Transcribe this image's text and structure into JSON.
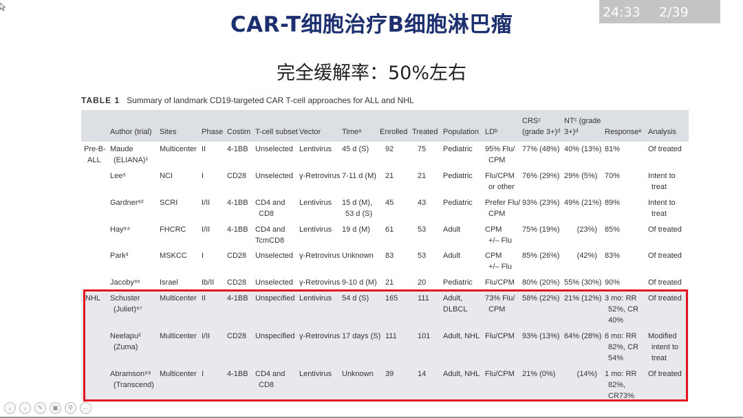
{
  "slide": {
    "title": "CAR-T细胞治疗B细胞淋巴瘤",
    "subtitle": "完全缓解率：50%左右",
    "timer": {
      "elapsed": "24:33",
      "page": "2/39"
    }
  },
  "table": {
    "caption_label": "TABLE 1",
    "caption_text": "Summary of landmark CD19-targeted CAR T-cell approaches for ALL and NHL",
    "headers": [
      "Author (trial)",
      "Sites",
      "Phase",
      "Costim",
      "T-cell subset",
      "Vector",
      "Timeᵃ",
      "Enrolled",
      "Treated",
      "Population",
      "LDᵇ",
      "CRSᶜ (grade 3+)ᵈ",
      "NTᶜ (grade 3+)ᵈ",
      "Responseᵉ",
      "Analysis"
    ],
    "groups": {
      "preb_line1": "Pre-B-",
      "preb_line2": "ALL",
      "nhl": "NHL"
    },
    "rows": [
      {
        "author": [
          "Maude",
          "(ELIANA)¹"
        ],
        "sites": "Multicenter",
        "phase": "II",
        "costim": "4-1BB",
        "tcell": [
          "Unselected"
        ],
        "vector": "Lentivirus",
        "time": [
          "45 d (S)"
        ],
        "enrolled": "92",
        "treated": "75",
        "population": [
          "Pediatric"
        ],
        "ld": [
          "95% Flu/",
          "CPM"
        ],
        "crs": "77% (48%)",
        "nt": "40% (13%)",
        "response": [
          "81%"
        ],
        "analysis": [
          "Of treated"
        ]
      },
      {
        "author": [
          "Lee⁵"
        ],
        "sites": "NCI",
        "phase": "I",
        "costim": "CD28",
        "tcell": [
          "Unselected"
        ],
        "vector": "γ-Retrovirus",
        "time": [
          "7-11 d (M)"
        ],
        "enrolled": "21",
        "treated": "21",
        "population": [
          "Pediatric"
        ],
        "ld": [
          "Flu/CPM",
          "or other"
        ],
        "crs": "76% (29%)",
        "nt": "29% (5%)",
        "response": [
          "70%"
        ],
        "analysis": [
          "Intent to",
          "treat"
        ]
      },
      {
        "author": [
          "Gardner⁸²"
        ],
        "sites": "SCRI",
        "phase": "I/II",
        "costim": "4-1BB",
        "tcell": [
          "CD4 and",
          "CD8"
        ],
        "vector": "Lentivirus",
        "time": [
          "15 d (M),",
          "53 d (S)"
        ],
        "enrolled": "45",
        "treated": "43",
        "population": [
          "Pediatric"
        ],
        "ld": [
          "Prefer Flu/",
          "CPM"
        ],
        "crs": "93% (23%)",
        "nt": "49% (21%)",
        "response": [
          "89%"
        ],
        "analysis": [
          "Intent to",
          "treat"
        ]
      },
      {
        "author": [
          "Hay⁸⁴"
        ],
        "sites": "FHCRC",
        "phase": "I/II",
        "costim": "4-1BB",
        "tcell": [
          "CD4 and",
          "TcmCD8"
        ],
        "vector": "Lentivirus",
        "time": [
          "19 d (M)"
        ],
        "enrolled": "61",
        "treated": "53",
        "population": [
          "Adult"
        ],
        "ld": [
          "CPM",
          "+/– Flu"
        ],
        "crs": "75% (19%)",
        "nt": "(23%)",
        "response": [
          "85%"
        ],
        "analysis": [
          "Of treated"
        ]
      },
      {
        "author": [
          "Park³"
        ],
        "sites": "MSKCC",
        "phase": "I",
        "costim": "CD28",
        "tcell": [
          "Unselected"
        ],
        "vector": "γ-Retrovirus",
        "time": [
          "Unknown"
        ],
        "enrolled": "83",
        "treated": "53",
        "population": [
          "Adult"
        ],
        "ld": [
          "CPM",
          "+/– Flu"
        ],
        "crs": "85% (26%)",
        "nt": "(42%)",
        "response": [
          "83%"
        ],
        "analysis": [
          "Of treated"
        ]
      },
      {
        "author": [
          "Jacoby⁸⁶"
        ],
        "sites": "Israel",
        "phase": "Ib/II",
        "costim": "CD28",
        "tcell": [
          "Unselected"
        ],
        "vector": "γ-Retrovirus",
        "time": [
          "9-10 d (M)"
        ],
        "enrolled": "21",
        "treated": "20",
        "population": [
          "Pediatric"
        ],
        "ld": [
          "Flu/CPM"
        ],
        "crs": "80% (20%)",
        "nt": "55% (30%)",
        "response": [
          "90%"
        ],
        "analysis": [
          "Of treated"
        ]
      },
      {
        "author": [
          "Schuster",
          "(Juliet)⁹⁷"
        ],
        "sites": "Multicenter",
        "phase": "II",
        "costim": "4-1BB",
        "tcell": [
          "Unspecified"
        ],
        "vector": "Lentivirus",
        "time": [
          "54 d (S)"
        ],
        "enrolled": "165",
        "treated": "111",
        "population": [
          "Adult,",
          "DLBCL"
        ],
        "ld": [
          "73% Flu/",
          "CPM"
        ],
        "crs": "58% (22%)",
        "nt": "21% (12%)",
        "response": [
          "3 mo: RR",
          "52%, CR",
          "40%"
        ],
        "analysis": [
          "Of treated"
        ]
      },
      {
        "author": [
          "Neelapu²",
          "(Zuma)"
        ],
        "sites": "Multicenter",
        "phase": "I/II",
        "costim": "CD28",
        "tcell": [
          "Unspecified"
        ],
        "vector": "γ-Retrovirus",
        "time": [
          "17 days (S)"
        ],
        "enrolled": "111",
        "treated": "101",
        "population": [
          "Adult, NHL"
        ],
        "ld": [
          "Flu/CPM"
        ],
        "crs": "93% (13%)",
        "nt": "64% (28%)",
        "response": [
          "6 mo: RR",
          "82%, CR",
          "54%"
        ],
        "analysis": [
          "Modified",
          "intent to",
          "treat"
        ]
      },
      {
        "author": [
          "Abramson⁹⁸",
          "(Transcend)"
        ],
        "sites": "Multicenter",
        "phase": "I",
        "costim": "4-1BB",
        "tcell": [
          "CD4 and",
          "CD8"
        ],
        "vector": "Lentivirus",
        "time": [
          "Unknown"
        ],
        "enrolled": "39",
        "treated": "14",
        "population": [
          "Adult, NHL"
        ],
        "ld": [
          "Flu/CPM"
        ],
        "crs": "21% (0%)",
        "nt": "(14%)",
        "response": [
          "1 mo: RR",
          "82%,",
          "CR73%"
        ],
        "analysis": [
          "Of treated"
        ]
      }
    ]
  },
  "toolbar": {
    "icons": [
      "prev-icon",
      "next-icon",
      "pen-icon",
      "slides-icon",
      "zoom-icon",
      "more-icon"
    ],
    "glyphs": [
      "‹",
      "›",
      "✎",
      "▣",
      "⚲",
      "···"
    ]
  },
  "colors": {
    "title": "#1c2f6e",
    "highlight_border": "#e3141b",
    "header_band": "#dcdfe4",
    "timer_bg": "#c4c4c4"
  }
}
